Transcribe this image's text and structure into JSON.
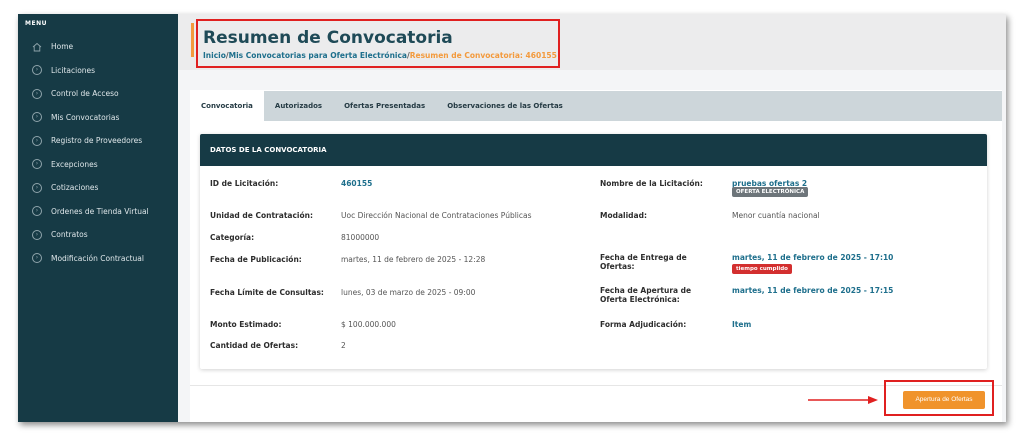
{
  "sidebar": {
    "menu_label": "MENU",
    "items": [
      {
        "label": "Home",
        "icon": "home-icon"
      },
      {
        "label": "Licitaciones",
        "icon": "chevron-right-icon"
      },
      {
        "label": "Control de Acceso",
        "icon": "chevron-right-icon"
      },
      {
        "label": "Mis Convocatorias",
        "icon": "chevron-right-icon"
      },
      {
        "label": "Registro de Proveedores",
        "icon": "chevron-right-icon"
      },
      {
        "label": "Excepciones",
        "icon": "chevron-right-icon"
      },
      {
        "label": "Cotizaciones",
        "icon": "chevron-right-icon"
      },
      {
        "label": "Ordenes de Tienda Virtual",
        "icon": "chevron-right-icon"
      },
      {
        "label": "Contratos",
        "icon": "chevron-right-icon"
      },
      {
        "label": "Modificación Contractual",
        "icon": "chevron-right-icon"
      }
    ]
  },
  "header": {
    "title": "Resumen de Convocatoria",
    "breadcrumb": {
      "home": "Inicio",
      "sep": "/",
      "parent": "Mis Convocatorias para Oferta Electrónica",
      "current": "Resumen de Convocatoria: 460155"
    }
  },
  "tabs": [
    {
      "label": "Convocatoria",
      "active": true
    },
    {
      "label": "Autorizados",
      "active": false
    },
    {
      "label": "Ofertas Presentadas",
      "active": false
    },
    {
      "label": "Observaciones de las Ofertas",
      "active": false
    }
  ],
  "card": {
    "title": "DATOS DE LA CONVOCATORIA",
    "fields": {
      "id_label": "ID de Licitación:",
      "id_value": "460155",
      "unidad_label": "Unidad de Contratación:",
      "unidad_value": "Uoc Dirección Nacional de Contrataciones Públicas",
      "categoria_label": "Categoría:",
      "categoria_value": "81000000",
      "fecha_pub_label": "Fecha de Publicación:",
      "fecha_pub_value": "martes, 11 de febrero de 2025 - 12:28",
      "fecha_limite_label": "Fecha Límite de Consultas:",
      "fecha_limite_value": "lunes, 03 de marzo de 2025 - 09:00",
      "monto_label": "Monto Estimado:",
      "monto_value": "$ 100.000.000",
      "cantidad_label": "Cantidad de Ofertas:",
      "cantidad_value": "2",
      "nombre_label": "Nombre de la Licitación:",
      "nombre_value": "pruebas ofertas 2",
      "nombre_badge": "OFERTA ELECTRÓNICA",
      "modalidad_label": "Modalidad:",
      "modalidad_value": "Menor cuantía nacional",
      "fecha_entrega_label_1": "Fecha de Entrega de",
      "fecha_entrega_label_2": "Ofertas:",
      "fecha_entrega_value": "martes, 11 de febrero de 2025 - 17:10",
      "fecha_entrega_badge": "tiempo cumplido",
      "fecha_apertura_label_1": "Fecha de Apertura de",
      "fecha_apertura_label_2": "Oferta Electrónica:",
      "fecha_apertura_value": "martes, 11 de febrero de 2025 - 17:15",
      "forma_label": "Forma Adjudicación:",
      "forma_value": "Item"
    }
  },
  "actions": {
    "apertura_label": "Apertura de Ofertas"
  },
  "colors": {
    "sidebar_bg": "#163a45",
    "accent_orange": "#f0932b",
    "link_blue": "#1e6f8c",
    "highlight_red": "#e02020"
  }
}
